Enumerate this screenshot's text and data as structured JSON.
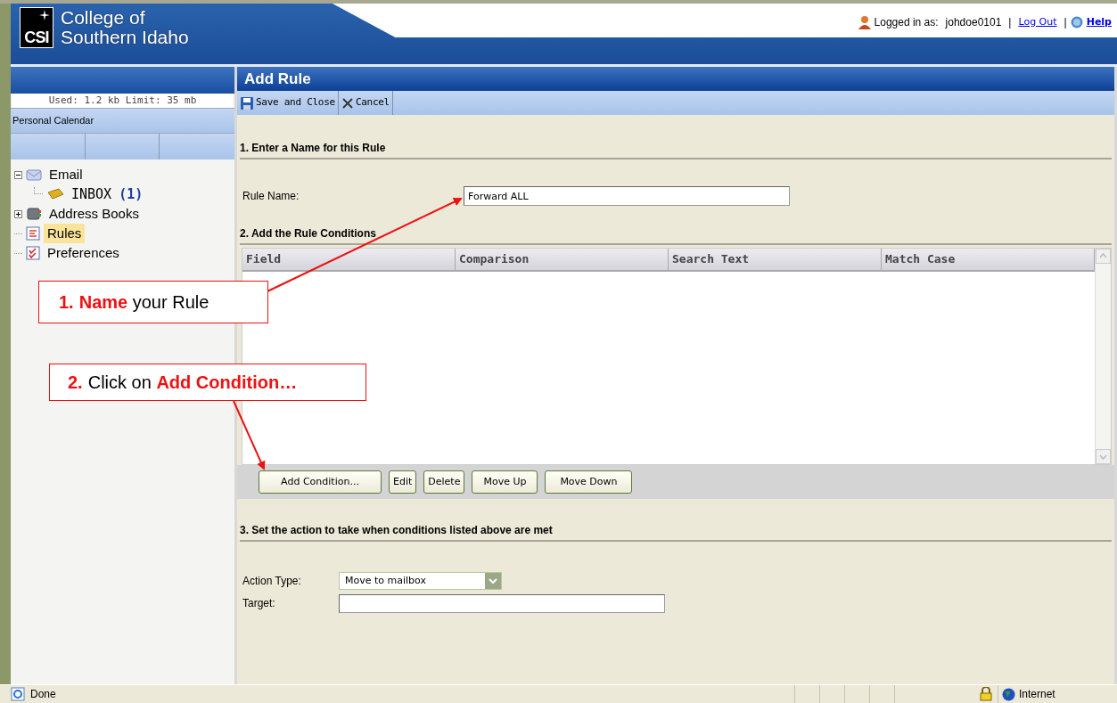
{
  "header": {
    "logo_mark": "CSI",
    "logo_lines": [
      "College of",
      "Southern Idaho"
    ],
    "logged_in_label": "Logged in as:",
    "username": "johdoe0101",
    "separators": [
      "|",
      "|"
    ],
    "logout": "Log Out",
    "help": "Help"
  },
  "sidebar": {
    "quota": "Used: 1.2 kb Limit: 35 mb",
    "calendar": "Personal Calendar",
    "tree": [
      {
        "label": "Email",
        "kind": "mail",
        "expanded": true,
        "selected": false,
        "children": [
          {
            "label": "INBOX",
            "count": "(1)",
            "kind": "inbox",
            "selected": false
          }
        ]
      },
      {
        "label": "Address Books",
        "kind": "book",
        "expanded": false,
        "selected": false
      },
      {
        "label": "Rules",
        "kind": "rules",
        "selected": true
      },
      {
        "label": "Preferences",
        "kind": "prefs",
        "selected": false
      }
    ]
  },
  "main": {
    "title": "Add Rule",
    "toolbar": [
      {
        "label": "Save and Close",
        "kind": "save"
      },
      {
        "label": "Cancel",
        "kind": "cancel"
      }
    ],
    "section1": "1. Enter a Name for this Rule",
    "rule_name_label": "Rule Name:",
    "rule_name_value": "Forward ALL",
    "section2": "2. Add the Rule Conditions",
    "columns": [
      "Field",
      "Comparison",
      "Search Text",
      "Match Case"
    ],
    "condition_buttons": [
      "Add Condition...",
      "Edit",
      "Delete",
      "Move Up",
      "Move Down"
    ],
    "section3": "3. Set the action to take when conditions listed above are met",
    "action_type_label": "Action Type:",
    "action_type_value": "Move to mailbox",
    "target_label": "Target:"
  },
  "annotations": [
    {
      "number": "1.",
      "text": "**Name** your Rule"
    },
    {
      "number": "2.",
      "text": "Click on **Add Condition…**"
    }
  ],
  "status_bar": {
    "text": "Done",
    "zone": "Internet"
  }
}
